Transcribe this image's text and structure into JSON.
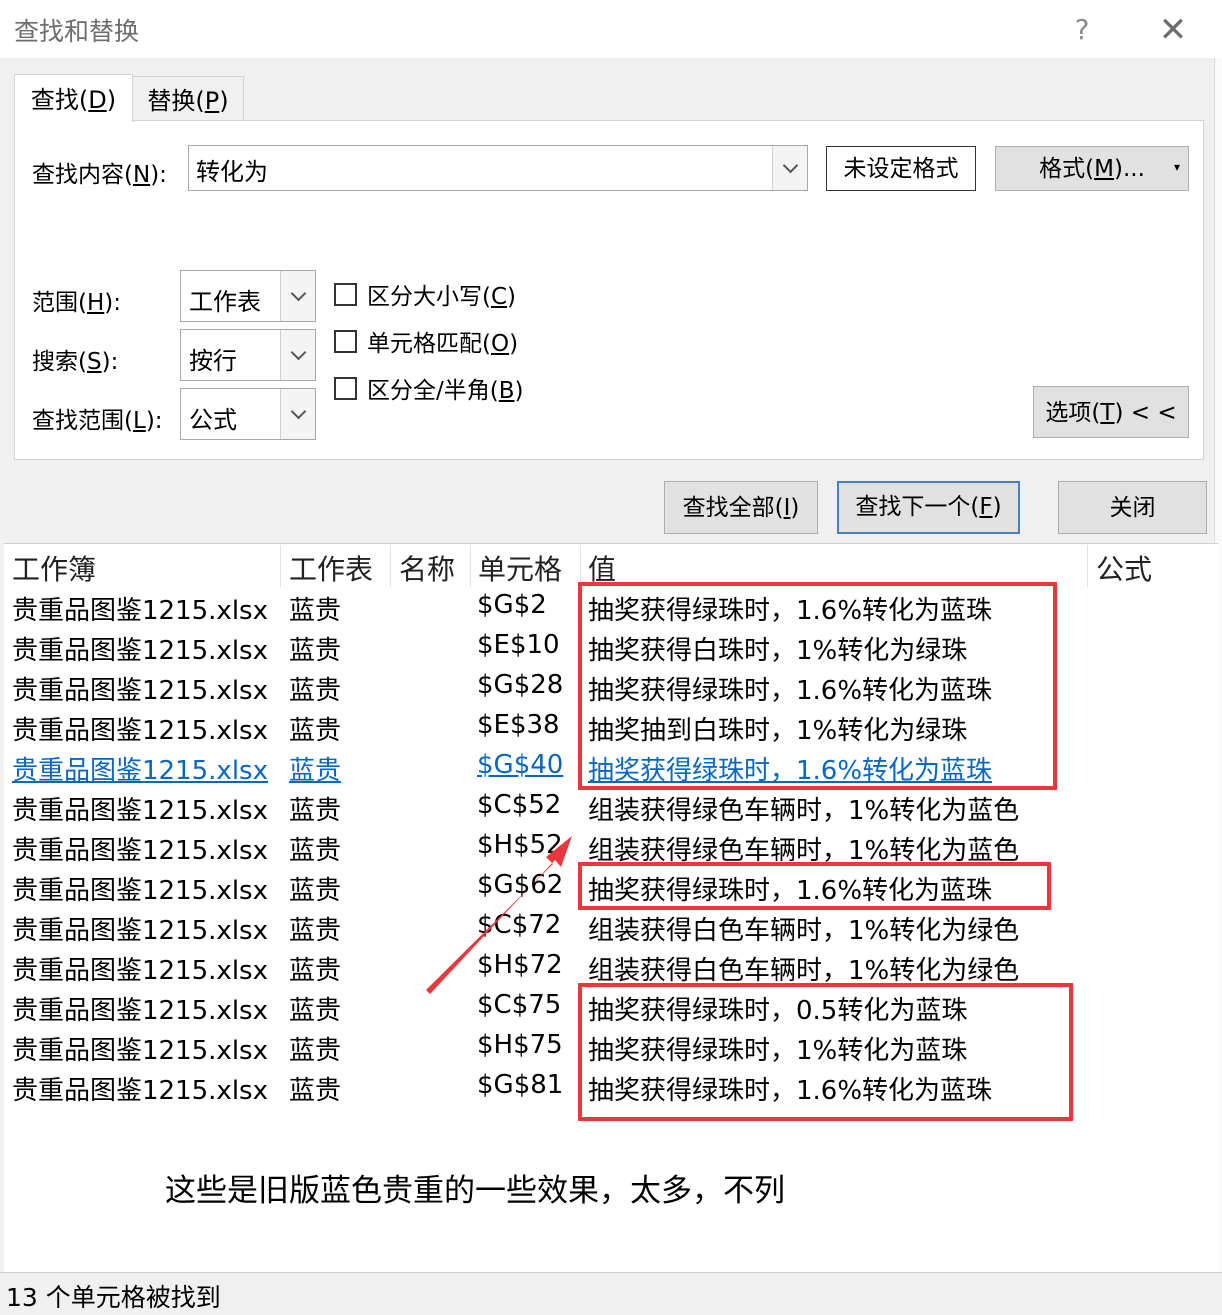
{
  "window": {
    "title": "查找和替换",
    "help": "?",
    "close": "✕"
  },
  "tabs": [
    {
      "label": "查找(",
      "key": "D",
      "suffix": ")"
    },
    {
      "label": "替换(",
      "key": "P",
      "suffix": ")"
    }
  ],
  "find": {
    "label": "查找内容(",
    "key": "N",
    "suffix": "):",
    "value": "转化为",
    "format_status": "未设定格式",
    "format_button": {
      "label": "格式(",
      "key": "M",
      "suffix": ")..."
    }
  },
  "options": {
    "within": {
      "label": "范围(",
      "key": "H",
      "suffix": "):",
      "value": "工作表"
    },
    "search": {
      "label": "搜索(",
      "key": "S",
      "suffix": "):",
      "value": "按行"
    },
    "look_in": {
      "label": "查找范围(",
      "key": "L",
      "suffix": "):",
      "value": "公式"
    },
    "checkboxes": [
      {
        "label": "区分大小写(",
        "key": "C",
        "suffix": ")",
        "checked": false
      },
      {
        "label": "单元格匹配(",
        "key": "O",
        "suffix": ")",
        "checked": false
      },
      {
        "label": "区分全/半角(",
        "key": "B",
        "suffix": ")",
        "checked": false
      }
    ],
    "options_button": {
      "label": "选项(",
      "key": "T",
      "suffix": ") < <"
    }
  },
  "actions": {
    "find_all": {
      "label": "查找全部(",
      "key": "I",
      "suffix": ")"
    },
    "find_next": {
      "label": "查找下一个(",
      "key": "F",
      "suffix": ")"
    },
    "close": "关闭"
  },
  "results": {
    "headers": [
      "工作簿",
      "工作表",
      "名称",
      "单元格",
      "值",
      "公式"
    ],
    "rows": [
      {
        "book": "贵重品图鉴1215.xlsx",
        "sheet": "蓝贵",
        "cell": "$G$2",
        "value": "抽奖获得绿珠时，1.6%转化为蓝珠"
      },
      {
        "book": "贵重品图鉴1215.xlsx",
        "sheet": "蓝贵",
        "cell": "$E$10",
        "value": "抽奖获得白珠时，1%转化为绿珠"
      },
      {
        "book": "贵重品图鉴1215.xlsx",
        "sheet": "蓝贵",
        "cell": "$G$28",
        "value": "抽奖获得绿珠时，1.6%转化为蓝珠"
      },
      {
        "book": "贵重品图鉴1215.xlsx",
        "sheet": "蓝贵",
        "cell": "$E$38",
        "value": "抽奖抽到白珠时，1%转化为绿珠"
      },
      {
        "book": "贵重品图鉴1215.xlsx",
        "sheet": "蓝贵",
        "cell": "$G$40",
        "value": "抽奖获得绿珠时，1.6%转化为蓝珠",
        "selected": true
      },
      {
        "book": "贵重品图鉴1215.xlsx",
        "sheet": "蓝贵",
        "cell": "$C$52",
        "value": "组装获得绿色车辆时，1%转化为蓝色"
      },
      {
        "book": "贵重品图鉴1215.xlsx",
        "sheet": "蓝贵",
        "cell": "$H$52",
        "value": "组装获得绿色车辆时，1%转化为蓝色"
      },
      {
        "book": "贵重品图鉴1215.xlsx",
        "sheet": "蓝贵",
        "cell": "$G$62",
        "value": "抽奖获得绿珠时，1.6%转化为蓝珠"
      },
      {
        "book": "贵重品图鉴1215.xlsx",
        "sheet": "蓝贵",
        "cell": "$C$72",
        "value": "组装获得白色车辆时，1%转化为绿色"
      },
      {
        "book": "贵重品图鉴1215.xlsx",
        "sheet": "蓝贵",
        "cell": "$H$72",
        "value": "组装获得白色车辆时，1%转化为绿色"
      },
      {
        "book": "贵重品图鉴1215.xlsx",
        "sheet": "蓝贵",
        "cell": "$C$75",
        "value": "抽奖获得绿珠时，0.5转化为蓝珠"
      },
      {
        "book": "贵重品图鉴1215.xlsx",
        "sheet": "蓝贵",
        "cell": "$H$75",
        "value": "抽奖获得绿珠时，1%转化为蓝珠"
      },
      {
        "book": "贵重品图鉴1215.xlsx",
        "sheet": "蓝贵",
        "cell": "$G$81",
        "value": "抽奖获得绿珠时，1.6%转化为蓝珠"
      }
    ]
  },
  "annotation": {
    "note": "这些是旧版蓝色贵重的一些效果，太多，不列",
    "highlight_color": "#e8383d"
  },
  "status": {
    "text": "13 个单元格被找到"
  },
  "colors": {
    "link": "#0a66c2",
    "default_button_border": "#4a7fbf"
  }
}
